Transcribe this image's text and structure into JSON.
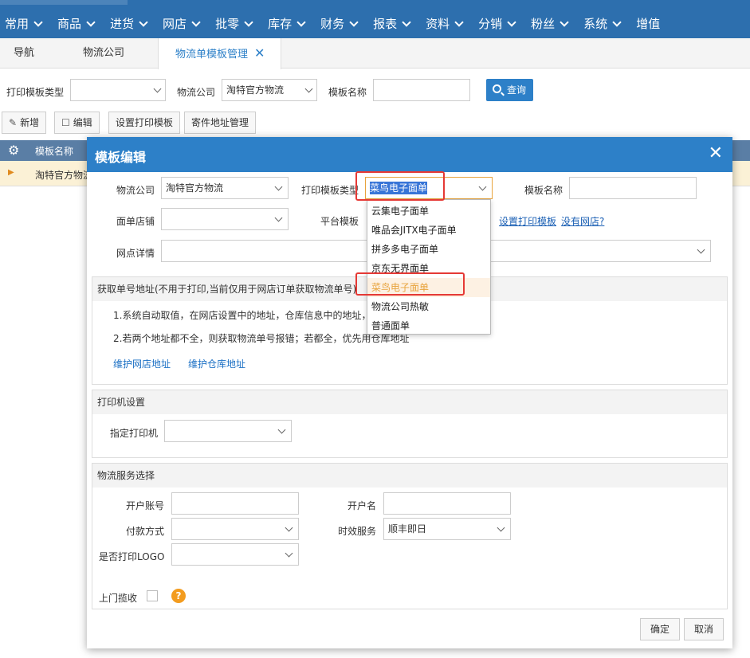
{
  "nav": {
    "items": [
      {
        "label": "常用"
      },
      {
        "label": "商品"
      },
      {
        "label": "进货"
      },
      {
        "label": "网店"
      },
      {
        "label": "批零"
      },
      {
        "label": "库存"
      },
      {
        "label": "财务"
      },
      {
        "label": "报表"
      },
      {
        "label": "资料"
      },
      {
        "label": "分销"
      },
      {
        "label": "粉丝"
      },
      {
        "label": "系统"
      },
      {
        "label": "增值"
      }
    ]
  },
  "tabs": {
    "items": [
      {
        "label": "导航"
      },
      {
        "label": "物流公司"
      },
      {
        "label": "物流单模板管理",
        "close": "✕"
      }
    ]
  },
  "filter": {
    "print_type_label": "打印模板类型",
    "print_type_value": "",
    "logistics_label": "物流公司",
    "logistics_value": "淘特官方物流",
    "template_name_label": "模板名称",
    "template_name_value": "",
    "query_button": "查询"
  },
  "toolbar": {
    "add": "新增",
    "edit": "编辑",
    "set_print_template": "设置打印模板",
    "sender_address": "寄件地址管理"
  },
  "grid": {
    "header_template_name": "模板名称",
    "row_template_name": "淘特官方物流"
  },
  "modal": {
    "title": "模板编辑",
    "close": "✕",
    "logistics_label": "物流公司",
    "logistics_value": "淘特官方物流",
    "print_type_label": "打印模板类型",
    "print_type_value": "菜鸟电子面单",
    "template_name_label": "模板名称",
    "template_name_value": "",
    "shop_label": "面单店铺",
    "shop_value": "",
    "platform_template_label": "平台模板",
    "set_print_template_link": "设置打印模板",
    "no_shop_link": "没有网店?",
    "outlet_label": "网点详情",
    "outlet_value": "",
    "dropdown_options": [
      {
        "label": "云集电子面单"
      },
      {
        "label": "唯品会JITX电子面单"
      },
      {
        "label": "拼多多电子面单"
      },
      {
        "label": "京东无界面单"
      },
      {
        "label": "菜鸟电子面单"
      },
      {
        "label": "物流公司热敏"
      },
      {
        "label": "普通面单"
      }
    ],
    "address_section": {
      "title": "获取单号地址(不用于打印,当前仅用于网店订单获取物流单号)",
      "line1": "1.系统自动取值，在网店设置中的地址，仓库信息中的地址，",
      "line2": "2.若两个地址都不全，则获取物流单号报错；若都全，优先用仓库地址",
      "link_shop": "维护网店地址",
      "link_warehouse": "维护仓库地址"
    },
    "printer_section": {
      "title": "打印机设置",
      "printer_label": "指定打印机",
      "printer_value": ""
    },
    "service_section": {
      "title": "物流服务选择",
      "account_label": "开户账号",
      "account_value": "",
      "account_name_label": "开户名",
      "account_name_value": "",
      "payment_label": "付款方式",
      "payment_value": "",
      "timeliness_label": "时效服务",
      "timeliness_value": "顺丰即日",
      "logo_label": "是否打印LOGO",
      "logo_value": "",
      "pickup_label": "上门揽收",
      "help_icon": "?"
    },
    "ok_button": "确定",
    "cancel_button": "取消"
  },
  "colors": {
    "nav_bg": "#2d6fae",
    "accent": "#2d80c8",
    "highlight_orange": "#e8a33c",
    "annotation_red": "#e53935"
  }
}
